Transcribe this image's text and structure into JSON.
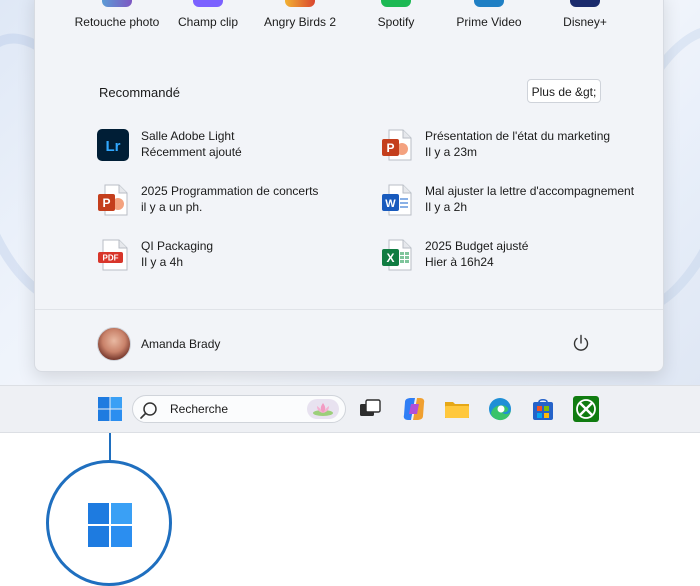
{
  "pinned_apps": [
    {
      "label": "Retouche photo",
      "icon": "photo-edit-icon",
      "color": "#6a5acd"
    },
    {
      "label": "Champ clip",
      "icon": "clipchamp-icon",
      "color": "#7b61ff"
    },
    {
      "label": "Angry Birds 2",
      "icon": "angry-birds-icon",
      "color": "#d9452f"
    },
    {
      "label": "Spotify",
      "icon": "spotify-icon",
      "color": "#1db954"
    },
    {
      "label": "Prime Video",
      "icon": "prime-video-icon",
      "color": "#1f7fc4"
    },
    {
      "label": "Disney+",
      "icon": "disney-plus-icon",
      "color": "#1a2a6c"
    }
  ],
  "recommended": {
    "title": "Recommandé",
    "more_label": "Plus de &gt;",
    "items": [
      {
        "name": "Salle Adobe Light",
        "sub": "Récemment ajouté",
        "icon": "lightroom-icon"
      },
      {
        "name": "Présentation de l'état du marketing",
        "sub": "Il y a 23m",
        "icon": "powerpoint-icon"
      },
      {
        "name": "2025 Programmation de concerts",
        "sub": "il y a un ph.",
        "icon": "powerpoint-icon"
      },
      {
        "name": "Mal ajuster la lettre d'accompagnement",
        "sub": "Il y a 2h",
        "icon": "word-icon"
      },
      {
        "name": "QI Packaging",
        "sub": "Il y a 4h",
        "icon": "pdf-icon"
      },
      {
        "name": "2025 Budget ajusté",
        "sub": "Hier à 16h24",
        "icon": "excel-icon"
      }
    ],
    "icon_texts": {
      "lightroom": "Lr",
      "pdf": "PDF"
    }
  },
  "user": {
    "name": "Amanda Brady"
  },
  "taskbar": {
    "search_label": "Recherche"
  },
  "colors": {
    "accent": "#1f6fbf",
    "powerpoint": "#c43e1c",
    "word": "#185abd",
    "excel": "#107c41",
    "lightroom": "#001e36"
  }
}
